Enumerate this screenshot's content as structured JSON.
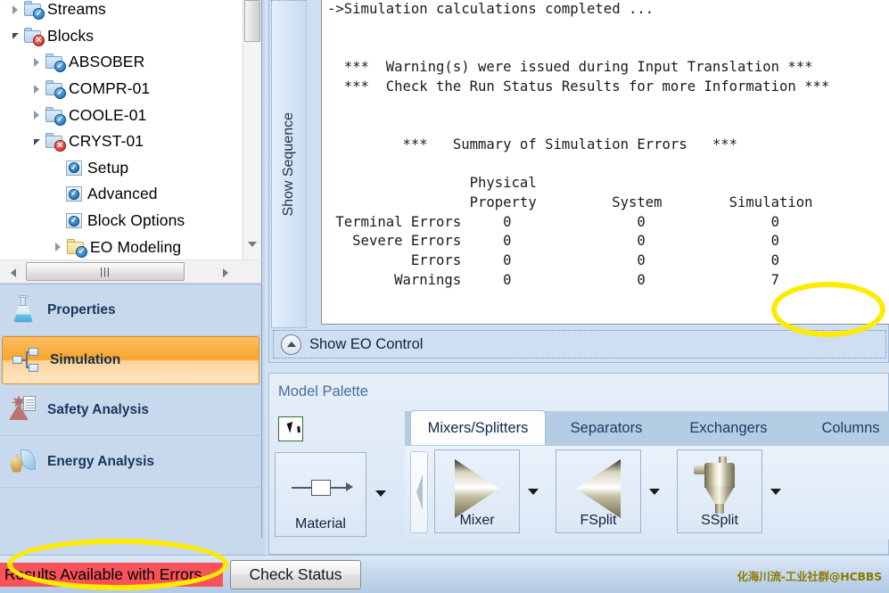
{
  "tree": {
    "items": [
      {
        "label": "Streams",
        "indent": 0,
        "twist": "closed",
        "icon": "folder-blue",
        "badge": "ok"
      },
      {
        "label": "Blocks",
        "indent": 0,
        "twist": "open",
        "icon": "folder-blue",
        "badge": "err"
      },
      {
        "label": "ABSOBER",
        "indent": 1,
        "twist": "closed",
        "icon": "folder-blue",
        "badge": "ok"
      },
      {
        "label": "COMPR-01",
        "indent": 1,
        "twist": "closed",
        "icon": "folder-blue",
        "badge": "ok"
      },
      {
        "label": "COOLE-01",
        "indent": 1,
        "twist": "closed",
        "icon": "folder-blue",
        "badge": "ok"
      },
      {
        "label": "CRYST-01",
        "indent": 1,
        "twist": "open",
        "icon": "folder-blue",
        "badge": "err"
      },
      {
        "label": "Setup",
        "indent": 2,
        "twist": "none",
        "icon": "checkbox-page",
        "badge": "ok"
      },
      {
        "label": "Advanced",
        "indent": 2,
        "twist": "none",
        "icon": "checkbox-page",
        "badge": "ok"
      },
      {
        "label": "Block Options",
        "indent": 2,
        "twist": "none",
        "icon": "checkbox-page",
        "badge": "ok"
      },
      {
        "label": "EO Modeling",
        "indent": 2,
        "twist": "closed",
        "icon": "folder-yellow",
        "badge": "ok"
      }
    ],
    "hscroll_grip": "|||"
  },
  "nav": {
    "items": [
      {
        "label": "Properties",
        "icon": "flask-icon",
        "selected": false
      },
      {
        "label": "Simulation",
        "icon": "simulation-blocks-icon",
        "selected": true
      },
      {
        "label": "Safety Analysis",
        "icon": "safety-analysis-icon",
        "selected": false
      },
      {
        "label": "Energy Analysis",
        "icon": "energy-analysis-icon",
        "selected": false
      }
    ]
  },
  "control_panel": {
    "sequence_tab_label": "Show Sequence",
    "output_text": "->Simulation calculations completed ...\n\n\n  ***  Warning(s) were issued during Input Translation ***\n  ***  Check the Run Status Results for more Information ***\n\n\n         ***   Summary of Simulation Errors   ***\n\n                 Physical\n                 Property         System        Simulation\n Terminal Errors     0               0               0\n   Severe Errors     0               0               0\n          Errors     0               0               0\n        Warnings     0               0               7",
    "eo_control_label": "Show EO Control",
    "error_summary": {
      "type": "table",
      "columns": [
        "",
        "Physical Property",
        "System",
        "Simulation"
      ],
      "rows": [
        {
          "label": "Terminal Errors",
          "physical_property": 0,
          "system": 0,
          "simulation": 0
        },
        {
          "label": "Severe Errors",
          "physical_property": 0,
          "system": 0,
          "simulation": 0
        },
        {
          "label": "Errors",
          "physical_property": 0,
          "system": 0,
          "simulation": 0
        },
        {
          "label": "Warnings",
          "physical_property": 0,
          "system": 0,
          "simulation": 7
        }
      ]
    }
  },
  "palette": {
    "title": "Model Palette",
    "tabs": [
      {
        "label": "Mixers/Splitters",
        "active": true
      },
      {
        "label": "Separators",
        "active": false
      },
      {
        "label": "Exchangers",
        "active": false
      },
      {
        "label": "Columns",
        "active": false
      }
    ],
    "material_card": {
      "label": "Material"
    },
    "blocks": [
      {
        "label": "Mixer",
        "glyph": "triangle-right"
      },
      {
        "label": "FSplit",
        "glyph": "triangle-left"
      },
      {
        "label": "SSplit",
        "glyph": "cyclone"
      }
    ]
  },
  "statusbar": {
    "status_text": "Results Available with Errors",
    "status_color": "#f9535a",
    "check_status_label": "Check Status",
    "watermark": "化海川流-工业社群@HCBBS"
  }
}
